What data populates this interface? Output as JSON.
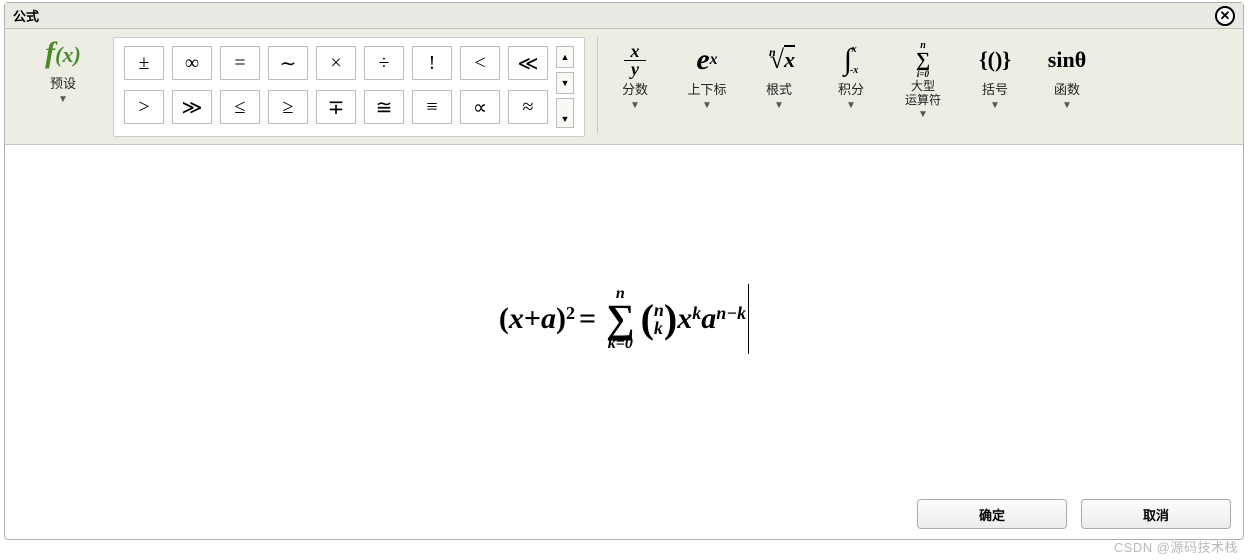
{
  "dialog": {
    "title": "公式"
  },
  "preset": {
    "label": "预设"
  },
  "symbols": {
    "row1": [
      "±",
      "∞",
      "=",
      "∼",
      "×",
      "÷",
      "!",
      "<",
      "≪"
    ],
    "row2": [
      ">",
      "≫",
      "≤",
      "≥",
      "∓",
      "≅",
      "≡",
      "∝",
      "≈"
    ]
  },
  "struct": {
    "fraction": "分数",
    "subsup": "上下标",
    "root": "根式",
    "integral": "积分",
    "largeop": "大型\n运算符",
    "bracket": "括号",
    "function": "函数"
  },
  "formula": {
    "lhs_open": "(",
    "lhs_var1": "x",
    "lhs_plus": "+",
    "lhs_var2": "a",
    "lhs_close": ")",
    "lhs_exp": "2",
    "eq": "=",
    "sum_top": "n",
    "sum_sigma": "∑",
    "sum_bottom": "k=0",
    "binom_top": "n",
    "binom_bot": "k",
    "term_x": "x",
    "term_x_exp": "k",
    "term_a": "a",
    "term_a_exp": "n−k"
  },
  "buttons": {
    "ok": "确定",
    "cancel": "取消"
  },
  "watermark": "CSDN @源码技术栈"
}
